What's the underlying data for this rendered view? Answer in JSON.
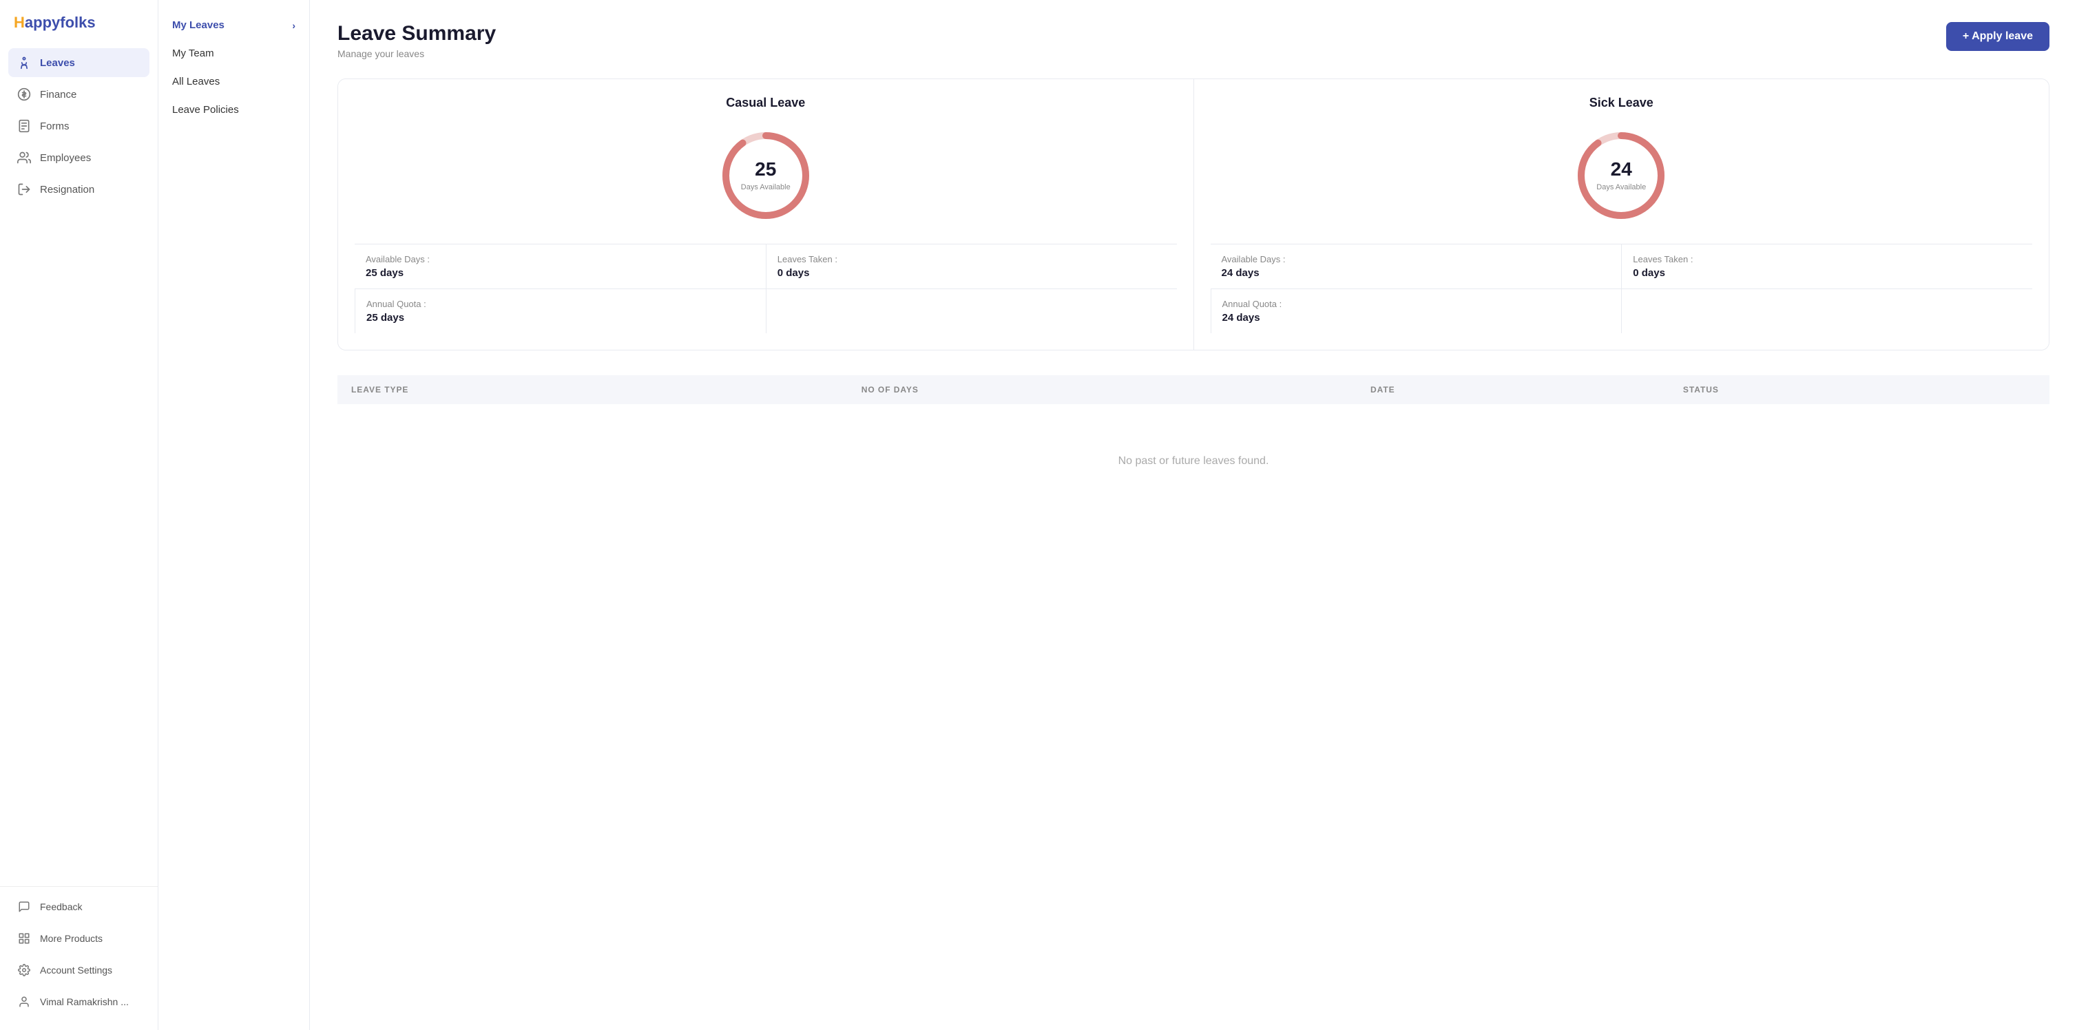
{
  "brand": {
    "name": "Happyfolks",
    "logo_h": "H",
    "logo_rest": "appyfolks"
  },
  "sidebar": {
    "items": [
      {
        "id": "leaves",
        "label": "Leaves",
        "icon": "run-icon",
        "active": true
      },
      {
        "id": "finance",
        "label": "Finance",
        "icon": "dollar-icon",
        "active": false
      },
      {
        "id": "forms",
        "label": "Forms",
        "icon": "form-icon",
        "active": false
      },
      {
        "id": "employees",
        "label": "Employees",
        "icon": "people-icon",
        "active": false
      },
      {
        "id": "resignation",
        "label": "Resignation",
        "icon": "exit-icon",
        "active": false
      }
    ],
    "bottom_items": [
      {
        "id": "feedback",
        "label": "Feedback",
        "icon": "feedback-icon"
      },
      {
        "id": "more-products",
        "label": "More Products",
        "icon": "grid-icon"
      },
      {
        "id": "account-settings",
        "label": "Account Settings",
        "icon": "gear-icon"
      },
      {
        "id": "user",
        "label": "Vimal Ramakrishn ...",
        "icon": "user-icon"
      }
    ]
  },
  "sub_sidebar": {
    "items": [
      {
        "id": "my-leaves",
        "label": "My Leaves",
        "active": true,
        "has_arrow": true
      },
      {
        "id": "my-team",
        "label": "My Team",
        "active": false,
        "has_arrow": false
      },
      {
        "id": "all-leaves",
        "label": "All Leaves",
        "active": false,
        "has_arrow": false
      },
      {
        "id": "leave-policies",
        "label": "Leave Policies",
        "active": false,
        "has_arrow": false
      }
    ]
  },
  "page": {
    "title": "Leave Summary",
    "subtitle": "Manage your leaves",
    "apply_button": "+ Apply leave"
  },
  "leave_cards": [
    {
      "id": "casual",
      "title": "Casual Leave",
      "days_available": 25,
      "days_label": "Days Available",
      "available_days_label": "Available Days :",
      "available_days_value": "25 days",
      "leaves_taken_label": "Leaves Taken :",
      "leaves_taken_value": "0 days",
      "annual_quota_label": "Annual Quota :",
      "annual_quota_value": "25 days",
      "progress_pct": 100
    },
    {
      "id": "sick",
      "title": "Sick Leave",
      "days_available": 24,
      "days_label": "Days Available",
      "available_days_label": "Available Days :",
      "available_days_value": "24 days",
      "leaves_taken_label": "Leaves Taken :",
      "leaves_taken_value": "0 days",
      "annual_quota_label": "Annual Quota :",
      "annual_quota_value": "24 days",
      "progress_pct": 100
    }
  ],
  "table": {
    "columns": [
      {
        "id": "leave-type",
        "label": "LEAVE TYPE"
      },
      {
        "id": "no-of-days",
        "label": "NO OF DAYS"
      },
      {
        "id": "date",
        "label": "DATE"
      },
      {
        "id": "status",
        "label": "STATUS"
      }
    ],
    "empty_message": "No past or future leaves found."
  },
  "colors": {
    "brand": "#3d4eac",
    "donut_stroke": "#d97b78",
    "donut_bg": "#f0d0ce"
  }
}
